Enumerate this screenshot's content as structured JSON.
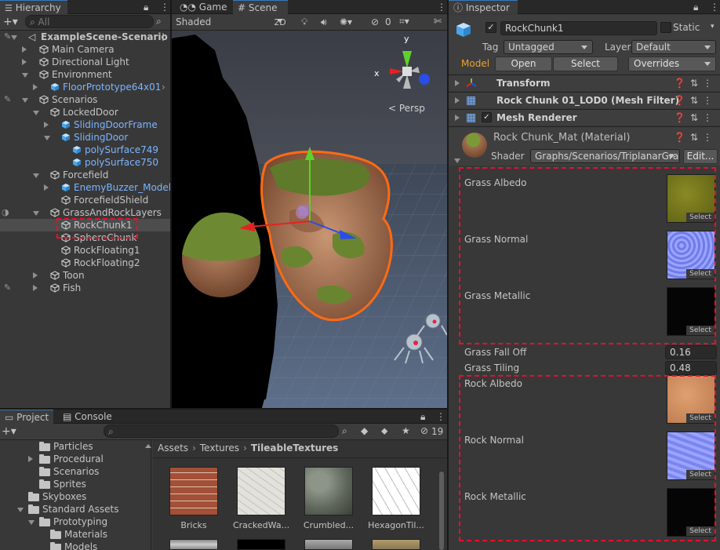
{
  "hierarchy": {
    "tab_label": "Hierarchy",
    "search_placeholder": "All",
    "items": [
      {
        "label": "ExampleScene-Scenario",
        "indent": 0,
        "kind": "scene",
        "open": true
      },
      {
        "label": "Main Camera",
        "indent": 1,
        "kind": "go",
        "open": false
      },
      {
        "label": "Directional Light",
        "indent": 1,
        "kind": "go",
        "open": false
      },
      {
        "label": "Environment",
        "indent": 1,
        "kind": "go",
        "open": true
      },
      {
        "label": "FloorPrototype64x01",
        "indent": 2,
        "kind": "prefab",
        "open": false
      },
      {
        "label": "Scenarios",
        "indent": 1,
        "kind": "go",
        "open": true
      },
      {
        "label": "LockedDoor",
        "indent": 2,
        "kind": "go",
        "open": true
      },
      {
        "label": "SlidingDoorFrame",
        "indent": 3,
        "kind": "prefab",
        "open": false
      },
      {
        "label": "SlidingDoor",
        "indent": 3,
        "kind": "prefab",
        "open": true
      },
      {
        "label": "polySurface749",
        "indent": 4,
        "kind": "prefab",
        "open": false
      },
      {
        "label": "polySurface750",
        "indent": 4,
        "kind": "prefab",
        "open": false
      },
      {
        "label": "Forcefield",
        "indent": 2,
        "kind": "go",
        "open": true
      },
      {
        "label": "EnemyBuzzer_Model",
        "indent": 3,
        "kind": "prefab",
        "open": false
      },
      {
        "label": "ForcefieldShield",
        "indent": 3,
        "kind": "go",
        "open": false
      },
      {
        "label": "GrassAndRockLayers",
        "indent": 2,
        "kind": "go",
        "open": true
      },
      {
        "label": "RockChunk1",
        "indent": 3,
        "kind": "go",
        "open": false
      },
      {
        "label": "SphereChunk",
        "indent": 3,
        "kind": "go",
        "open": false
      },
      {
        "label": "RockFloating1",
        "indent": 3,
        "kind": "go",
        "open": false
      },
      {
        "label": "RockFloating2",
        "indent": 3,
        "kind": "go",
        "open": false
      },
      {
        "label": "Toon",
        "indent": 2,
        "kind": "go",
        "open": false
      },
      {
        "label": "Fish",
        "indent": 2,
        "kind": "go",
        "open": false
      }
    ]
  },
  "scene": {
    "tab_game": "Game",
    "tab_scene": "Scene",
    "shading_mode": "Shaded",
    "btn_2d": "2D",
    "hidden_count": "0",
    "gizmo_x": "x",
    "gizmo_y": "y",
    "persp_label": "Persp"
  },
  "inspector": {
    "tab_label": "Inspector",
    "object_name": "RockChunk1",
    "static_label": "Static",
    "tag_label": "Tag",
    "tag_value": "Untagged",
    "layer_label": "Layer",
    "layer_value": "Default",
    "model_label": "Model",
    "open_label": "Open",
    "select_label": "Select",
    "overrides_label": "Overrides",
    "components": [
      "Transform",
      "Rock Chunk 01_LOD0 (Mesh Filter)",
      "Mesh Renderer"
    ],
    "material_name": "Rock Chunk_Mat (Material)",
    "shader_label": "Shader",
    "shader_value": "Graphs/Scenarios/TriplanarGra",
    "edit_label": "Edit...",
    "texture_select_label": "Select",
    "grass_props": [
      "Grass Albedo",
      "Grass Normal",
      "Grass Metallic"
    ],
    "grass_fall_off_label": "Grass Fall Off",
    "grass_fall_off_value": "0.16",
    "grass_tiling_label": "Grass Tiling",
    "grass_tiling_value": "0.48",
    "rock_props": [
      "Rock Albedo",
      "Rock Normal",
      "Rock Metallic"
    ]
  },
  "project": {
    "tab_project": "Project",
    "tab_console": "Console",
    "hidden_count": "19",
    "folders": [
      {
        "label": "Particles",
        "indent": 2,
        "arrow": false
      },
      {
        "label": "Procedural",
        "indent": 2,
        "arrow": true
      },
      {
        "label": "Scenarios",
        "indent": 2,
        "arrow": false
      },
      {
        "label": "Sprites",
        "indent": 2,
        "arrow": false
      },
      {
        "label": "Skyboxes",
        "indent": 1,
        "arrow": false
      },
      {
        "label": "Standard Assets",
        "indent": 1,
        "arrow": true,
        "open": true
      },
      {
        "label": "Prototyping",
        "indent": 2,
        "arrow": true,
        "open": true
      },
      {
        "label": "Materials",
        "indent": 3,
        "arrow": false
      },
      {
        "label": "Models",
        "indent": 3,
        "arrow": false
      }
    ],
    "breadcrumb": [
      "Assets",
      "Textures",
      "TileableTextures"
    ],
    "assets": [
      "Bricks",
      "CrackedWa...",
      "Crumbled...",
      "HexagonTil..."
    ]
  }
}
